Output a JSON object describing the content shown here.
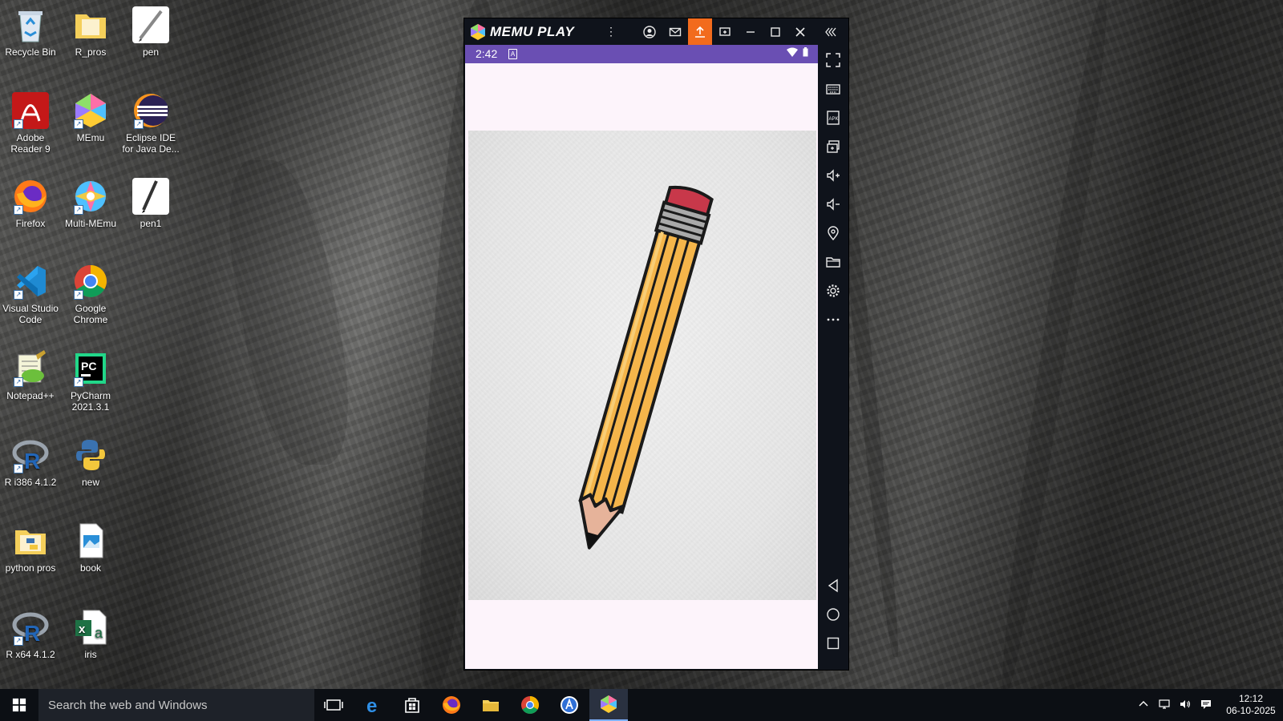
{
  "desktop": {
    "icons": [
      {
        "label": "Recycle Bin"
      },
      {
        "label": "R_pros"
      },
      {
        "label": "pen"
      },
      {
        "label": "Adobe Reader 9"
      },
      {
        "label": "MEmu"
      },
      {
        "label": "Eclipse IDE for Java De..."
      },
      {
        "label": "Firefox"
      },
      {
        "label": "Multi-MEmu"
      },
      {
        "label": "pen1"
      },
      {
        "label": "Visual Studio Code"
      },
      {
        "label": "Google Chrome"
      },
      {
        "label": "Notepad++"
      },
      {
        "label": "PyCharm 2021.3.1"
      },
      {
        "label": "R i386 4.1.2"
      },
      {
        "label": "new"
      },
      {
        "label": "python pros"
      },
      {
        "label": "book"
      },
      {
        "label": "R x64 4.1.2"
      },
      {
        "label": "iris"
      }
    ]
  },
  "memu": {
    "title": "MEMU PLAY",
    "accent": "#f26b1d",
    "status": {
      "time": "2:42",
      "notif": "A"
    }
  },
  "taskbar": {
    "search_placeholder": "Search the web and Windows",
    "clock_time": "12:12",
    "clock_date": "06-10-2025"
  }
}
